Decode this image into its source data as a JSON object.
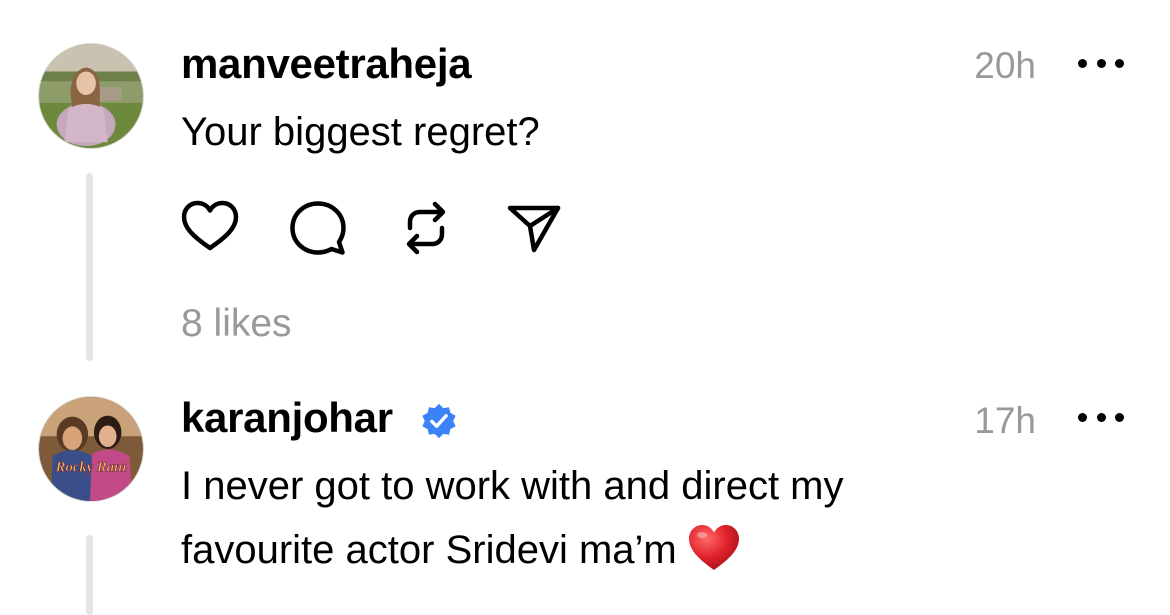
{
  "posts": [
    {
      "username": "manveetraheja",
      "verified": false,
      "timestamp": "20h",
      "text": "Your biggest regret?",
      "likes": "8 likes",
      "avatar_icon": "profile-photo-woman-outdoors"
    },
    {
      "username": "karanjohar",
      "verified": true,
      "timestamp": "17h",
      "text": "I never got to work with and direct my favourite actor Sridevi ma’m",
      "emoji": "red-heart-emoji",
      "avatar_icon": "movie-poster-rocky-rani",
      "avatar_text": "Rocky Rani"
    }
  ],
  "actions": [
    "heart-icon",
    "comment-icon",
    "repost-icon",
    "share-icon"
  ],
  "colors": {
    "text": "#000000",
    "secondary": "#999999",
    "verified": "#3b82f6",
    "thread_line": "#e5e5e5",
    "heart": "#e0222b"
  }
}
